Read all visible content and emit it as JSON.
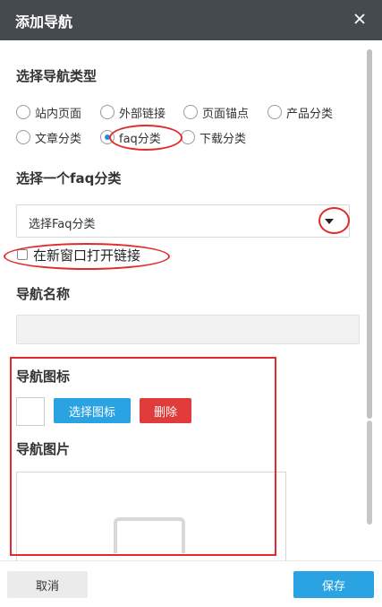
{
  "dialog": {
    "title": "添加导航",
    "close_icon": "close-icon"
  },
  "nav_type": {
    "label": "选择导航类型",
    "options": [
      {
        "label": "站内页面",
        "checked": false
      },
      {
        "label": "外部链接",
        "checked": false
      },
      {
        "label": "页面锚点",
        "checked": false
      },
      {
        "label": "产品分类",
        "checked": false
      },
      {
        "label": "文章分类",
        "checked": false
      },
      {
        "label": "faq分类",
        "checked": true
      },
      {
        "label": "下载分类",
        "checked": false
      }
    ]
  },
  "faq_category": {
    "label": "选择一个faq分类",
    "selected": "选择Faq分类"
  },
  "open_new_window": {
    "label": "在新窗口打开链接",
    "checked": false
  },
  "nav_name": {
    "label": "导航名称",
    "value": ""
  },
  "nav_icon": {
    "label": "导航图标",
    "select_button": "选择图标",
    "delete_button": "删除"
  },
  "nav_image": {
    "label": "导航图片"
  },
  "footer": {
    "cancel_label": "取消",
    "save_label": "保存"
  },
  "colors": {
    "titlebar": "#454a4f",
    "accent_blue": "#2aa3e2",
    "danger_red": "#e23b3b",
    "annotation_red": "#e12c2c"
  }
}
